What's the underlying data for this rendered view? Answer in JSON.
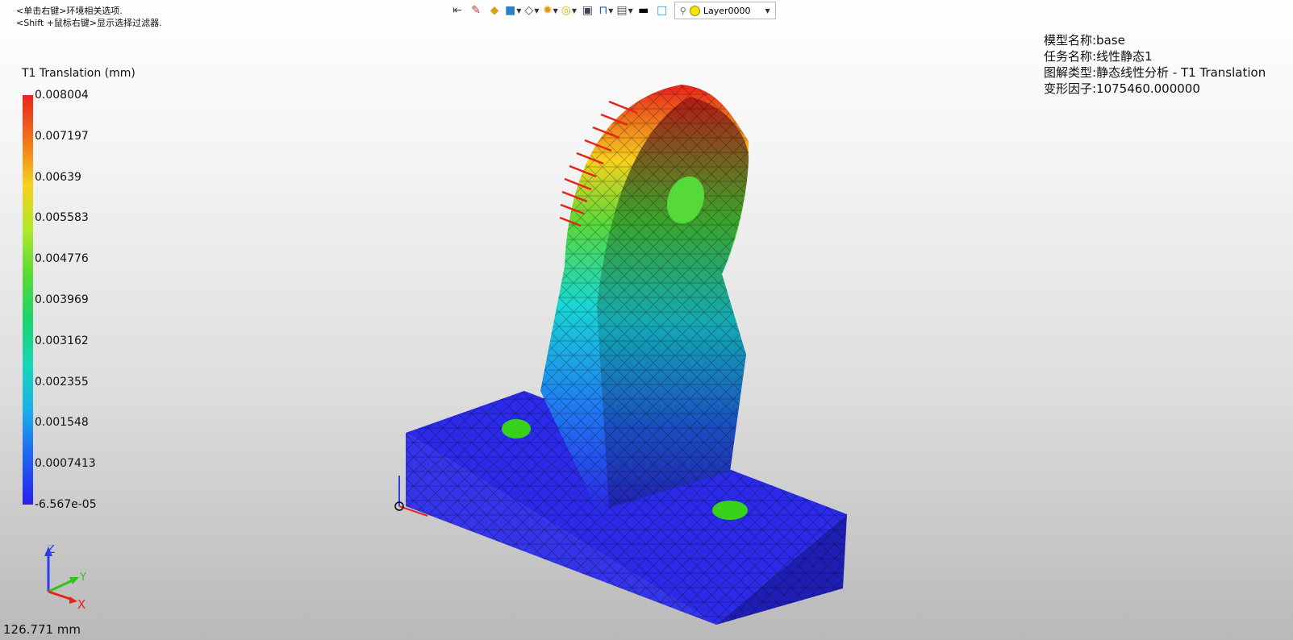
{
  "hints": {
    "line1": "<单击右键>环境相关选项.",
    "line2": "<Shift +鼠标右键>显示选择过滤器."
  },
  "toolbar": {
    "icons": [
      "exit-icon",
      "pen-icon",
      "solid-icon",
      "cube-icon",
      "wireframe-cube-icon",
      "shading-icon",
      "view-icon",
      "box-icon",
      "clip-icon",
      "display-icon",
      "line-color-icon",
      "fill-color-icon"
    ],
    "layer_label": "Layer0000"
  },
  "model_info": {
    "line1": "模型名称:base",
    "line2": "任务名称:线性静态1",
    "line3": "图解类型:静态线性分析 - T1 Translation",
    "line4": "变形因子:1075460.000000"
  },
  "legend": {
    "title": "T1 Translation (mm)",
    "values": [
      "0.008004",
      "0.007197",
      "0.00639",
      "0.005583",
      "0.004776",
      "0.003969",
      "0.003162",
      "0.002355",
      "0.001548",
      "0.0007413",
      "-6.567e-05"
    ],
    "colors": [
      "#e8231c",
      "#f0741e",
      "#f5d21e",
      "#b0e82a",
      "#56d93a",
      "#1fd26e",
      "#19d6b8",
      "#1faee8",
      "#1f66f0",
      "#2a1ee8"
    ]
  },
  "triad": {
    "z": "Z",
    "y": "Y",
    "x": "X"
  },
  "scale": "126.771 mm"
}
